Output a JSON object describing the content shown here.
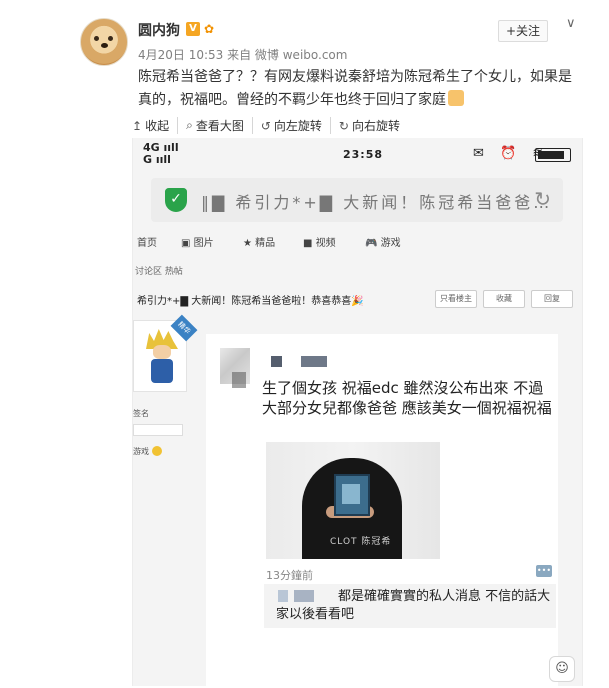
{
  "post": {
    "username": "圆内狗",
    "vip_badge": "V",
    "member_badge": "✿",
    "follow_label": "+关注",
    "menu_chevron": "∨",
    "meta": "4月20日 10:53 来自 微博 weibo.com",
    "text": "陈冠希当爸爸了？？有网友爆料说秦舒培为陈冠希生了个女儿，如果是真的，祝福吧。曾经的不羁少年也终于回归了家庭"
  },
  "image_toolbar": {
    "items": [
      {
        "icon": "↥",
        "label": "收起"
      },
      {
        "icon": "⌕",
        "label": "查看大图"
      },
      {
        "icon": "↺",
        "label": "向左旋转"
      },
      {
        "icon": "↻",
        "label": "向右旋转"
      }
    ]
  },
  "screenshot": {
    "status": {
      "network_top": "4G ııll",
      "network_bottom": "G ııll",
      "time": "23:58",
      "icons": "✉ ⏰ ≋"
    },
    "search": {
      "text": "‖▇ 希引力*+▇ 大新闻！陈冠希当爸爸…",
      "refresh": "↻"
    },
    "nav": [
      "首页",
      "图片",
      "精品",
      "视频",
      "游戏"
    ],
    "nav_icons": [
      "▤",
      "▣",
      "★",
      "■",
      "🎮"
    ],
    "sub_tabs": "讨论区   热帖",
    "hot_title": "希引力*+▇ 大新闻！陈冠希当爸爸啦！恭喜恭喜🎉",
    "hot_buttons": [
      "只看楼主",
      "收藏",
      "回复"
    ],
    "left_ribbon": "精华",
    "left_lines": [
      "签名",
      "游戏"
    ],
    "feed": {
      "post_text": "生了個女孩 祝福edc 雖然沒公布出來 不過大部分女兒都像爸爸 應該美女一個祝福祝福",
      "photo_shirt_text": "CLOT 陈冠希",
      "time": "13分鐘前",
      "comment_icon": "•••",
      "reply_text": "都是確確實實的私人消息 不信的話大家以後看看吧"
    },
    "emote_button": "☺"
  }
}
